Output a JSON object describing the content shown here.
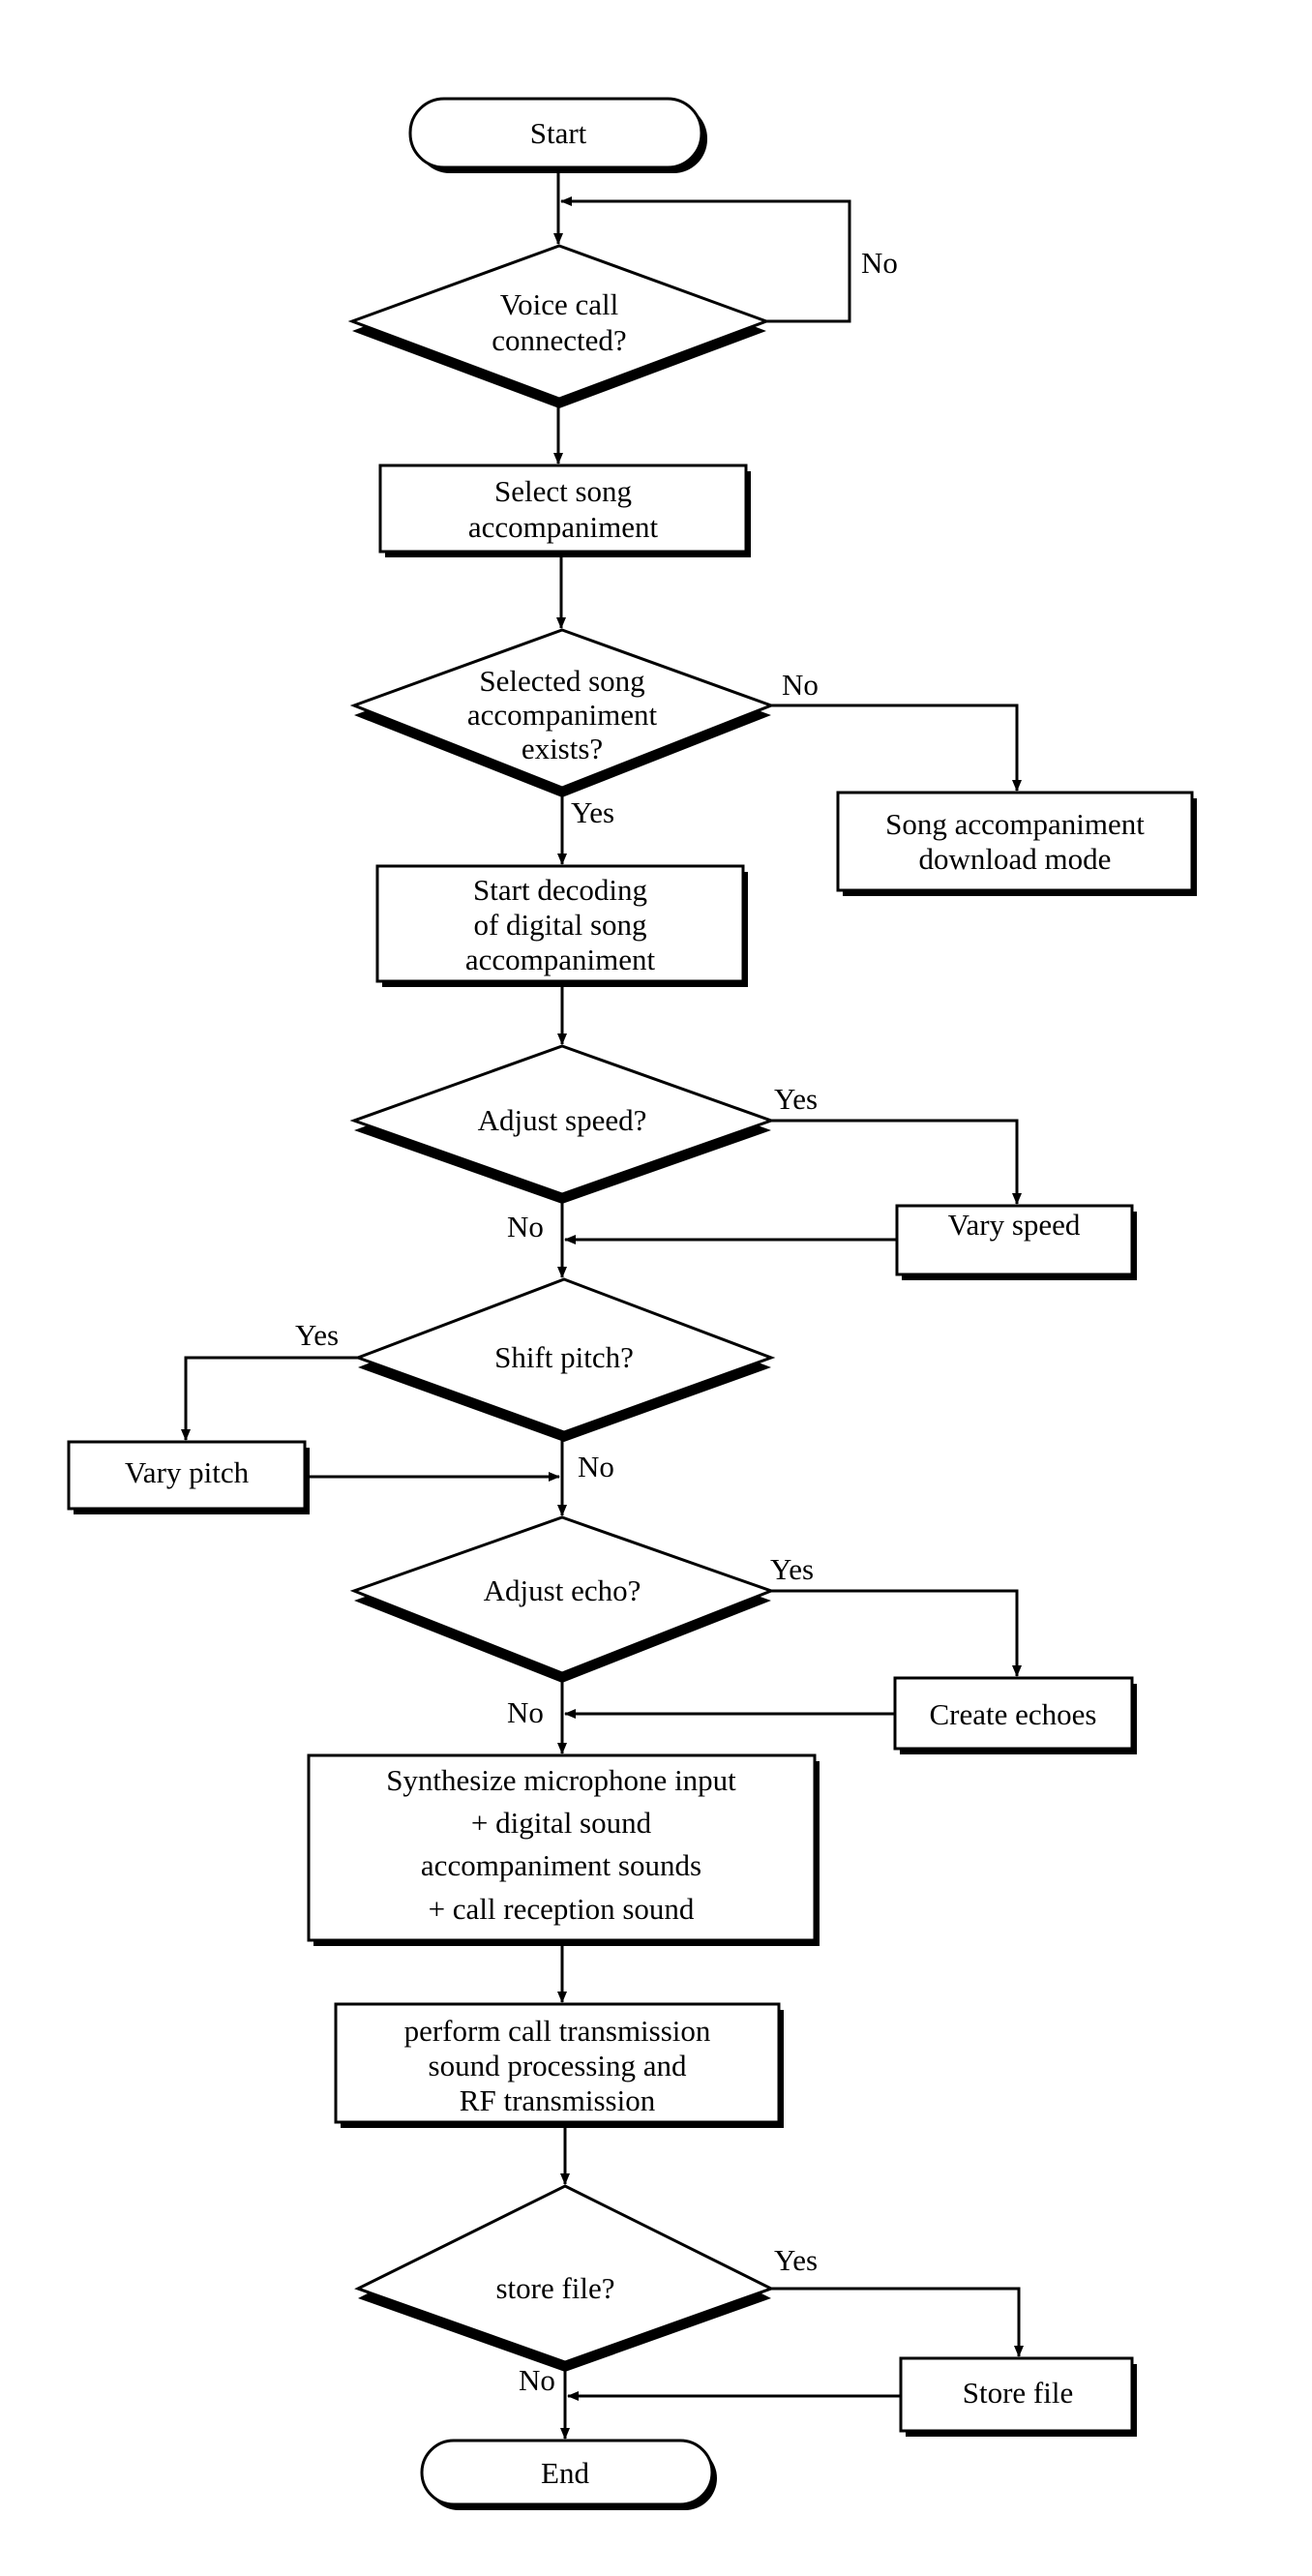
{
  "diagram": {
    "type": "flowchart",
    "nodes": [
      {
        "id": "start",
        "shape": "terminal",
        "lines": [
          "Start"
        ]
      },
      {
        "id": "voice_call",
        "shape": "decision",
        "lines": [
          "Voice call",
          "connected?"
        ]
      },
      {
        "id": "select_song",
        "shape": "process",
        "lines": [
          "Select song",
          "accompaniment"
        ]
      },
      {
        "id": "song_exists",
        "shape": "decision",
        "lines": [
          "Selected song",
          "accompaniment",
          "exists?"
        ]
      },
      {
        "id": "download_mode",
        "shape": "process",
        "lines": [
          "Song accompaniment",
          "download mode"
        ]
      },
      {
        "id": "start_decoding",
        "shape": "process",
        "lines": [
          "Start decoding",
          "of digital song",
          "accompaniment"
        ]
      },
      {
        "id": "adjust_speed",
        "shape": "decision",
        "lines": [
          "Adjust speed?"
        ]
      },
      {
        "id": "vary_speed",
        "shape": "process",
        "lines": [
          "Vary speed"
        ]
      },
      {
        "id": "shift_pitch",
        "shape": "decision",
        "lines": [
          "Shift pitch?"
        ]
      },
      {
        "id": "vary_pitch",
        "shape": "process",
        "lines": [
          "Vary pitch"
        ]
      },
      {
        "id": "adjust_echo",
        "shape": "decision",
        "lines": [
          "Adjust echo?"
        ]
      },
      {
        "id": "create_echoes",
        "shape": "process",
        "lines": [
          "Create echoes"
        ]
      },
      {
        "id": "synthesize",
        "shape": "process",
        "lines": [
          "Synthesize microphone input",
          "+ digital sound",
          "accompaniment sounds",
          "+ call reception sound"
        ]
      },
      {
        "id": "transmission",
        "shape": "process",
        "lines": [
          "perform call transmission",
          "sound processing and",
          "RF transmission"
        ]
      },
      {
        "id": "store_file_q",
        "shape": "decision",
        "lines": [
          "store file?"
        ]
      },
      {
        "id": "store_file",
        "shape": "process",
        "lines": [
          "Store file"
        ]
      },
      {
        "id": "end",
        "shape": "terminal",
        "lines": [
          "End"
        ]
      }
    ],
    "edges": [
      {
        "from": "start",
        "to": "voice_call",
        "label": ""
      },
      {
        "from": "voice_call",
        "to": "voice_call",
        "label": "No"
      },
      {
        "from": "voice_call",
        "to": "select_song",
        "label": ""
      },
      {
        "from": "select_song",
        "to": "song_exists",
        "label": ""
      },
      {
        "from": "song_exists",
        "to": "download_mode",
        "label": "No"
      },
      {
        "from": "song_exists",
        "to": "start_decoding",
        "label": "Yes"
      },
      {
        "from": "start_decoding",
        "to": "adjust_speed",
        "label": ""
      },
      {
        "from": "adjust_speed",
        "to": "vary_speed",
        "label": "Yes"
      },
      {
        "from": "adjust_speed",
        "to": "shift_pitch",
        "label": "No"
      },
      {
        "from": "vary_speed",
        "to": "shift_pitch",
        "label": ""
      },
      {
        "from": "shift_pitch",
        "to": "vary_pitch",
        "label": "Yes"
      },
      {
        "from": "shift_pitch",
        "to": "adjust_echo",
        "label": "No"
      },
      {
        "from": "vary_pitch",
        "to": "adjust_echo",
        "label": ""
      },
      {
        "from": "adjust_echo",
        "to": "create_echoes",
        "label": "Yes"
      },
      {
        "from": "adjust_echo",
        "to": "synthesize",
        "label": "No"
      },
      {
        "from": "create_echoes",
        "to": "synthesize",
        "label": ""
      },
      {
        "from": "synthesize",
        "to": "transmission",
        "label": ""
      },
      {
        "from": "transmission",
        "to": "store_file_q",
        "label": ""
      },
      {
        "from": "store_file_q",
        "to": "store_file",
        "label": "Yes"
      },
      {
        "from": "store_file_q",
        "to": "end",
        "label": "No"
      },
      {
        "from": "store_file",
        "to": "end",
        "label": ""
      }
    ]
  },
  "labels": {
    "yes": "Yes",
    "no": "No"
  }
}
